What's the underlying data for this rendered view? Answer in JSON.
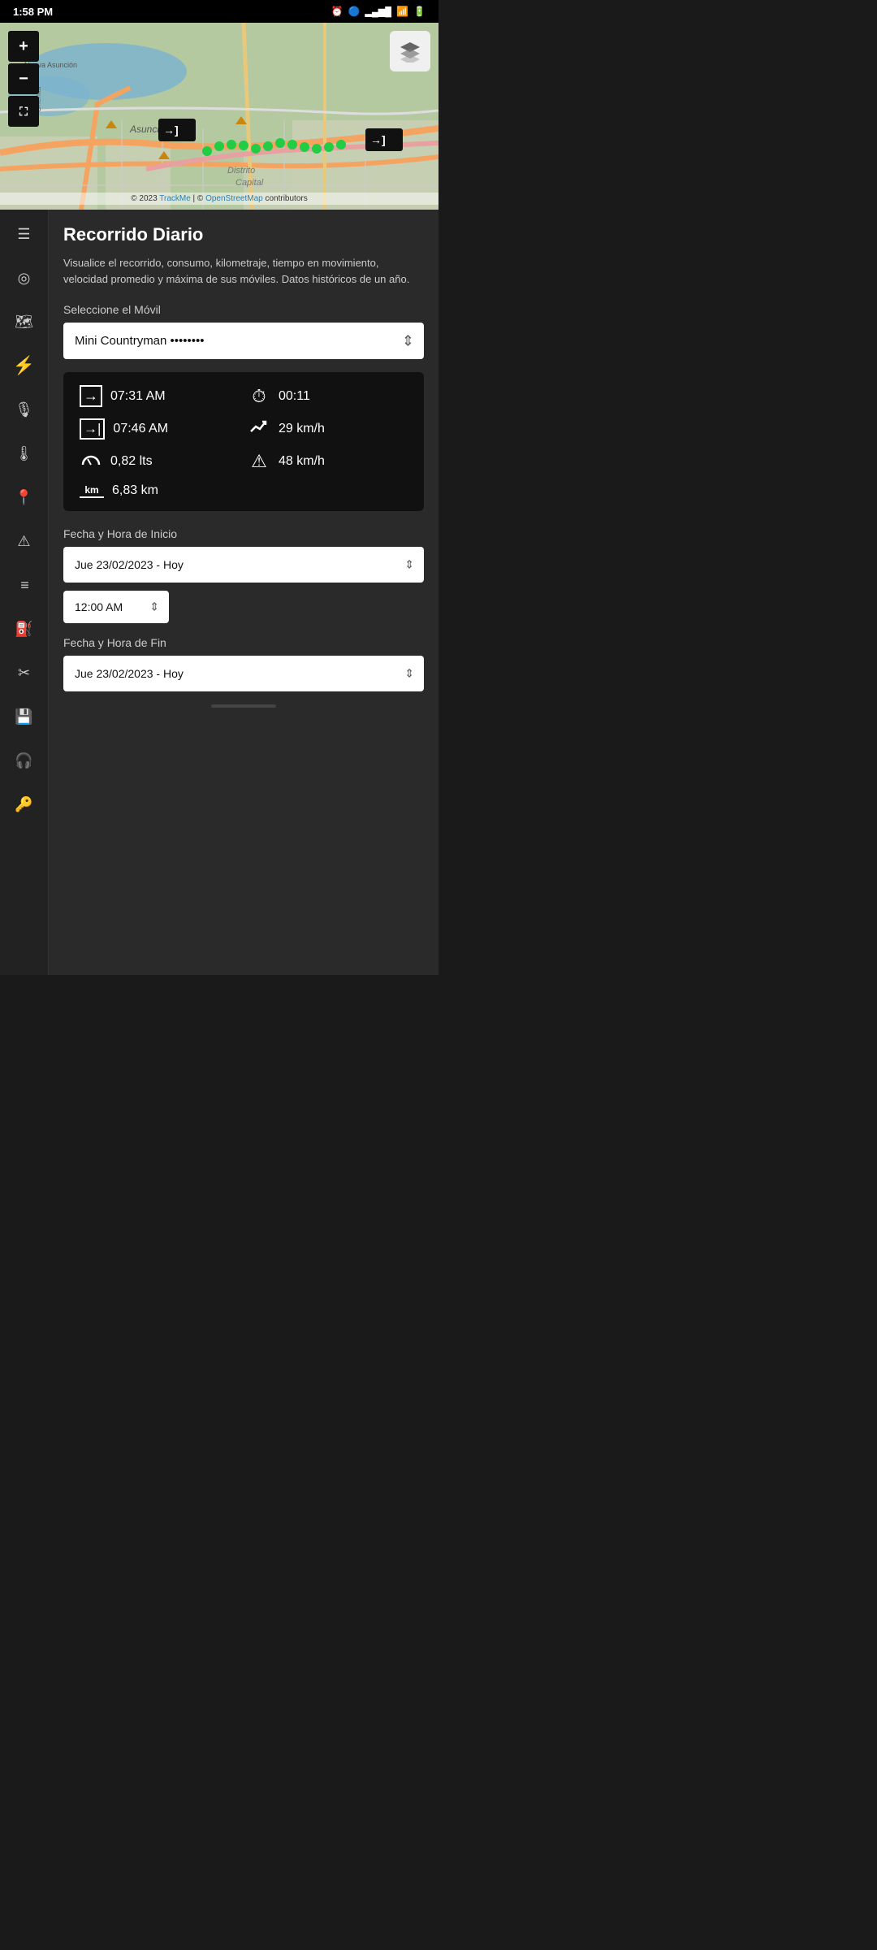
{
  "status_bar": {
    "time": "1:58 PM",
    "alarm_icon": "⏰",
    "bluetooth_icon": "⚡",
    "signal_icon": "📶",
    "wifi_icon": "📶",
    "battery_icon": "🔋"
  },
  "map": {
    "attribution": "© 2023 TrackMe | © OpenStreetMap contributors",
    "attribution_trackme": "TrackMe",
    "attribution_osm": "OpenStreetMap",
    "layers_icon": "layers-icon",
    "zoom_in_label": "+",
    "zoom_out_label": "−",
    "fit_icon": "⛶",
    "flag_start": "→]",
    "flag_end": "→]"
  },
  "sidebar": {
    "items": [
      {
        "name": "menu-icon",
        "label": "≡",
        "icon": "☰"
      },
      {
        "name": "location-icon",
        "label": "location",
        "icon": "◎"
      },
      {
        "name": "map-icon",
        "label": "map",
        "icon": "🗺"
      },
      {
        "name": "lightning-icon",
        "label": "lightning",
        "icon": "⚡"
      },
      {
        "name": "microphone-icon",
        "label": "microphone",
        "icon": "🎤"
      },
      {
        "name": "temperature-icon",
        "label": "temperature",
        "icon": "🌡"
      },
      {
        "name": "pin-icon",
        "label": "pin",
        "icon": "📍"
      },
      {
        "name": "alert-icon",
        "label": "alert",
        "icon": "⚠"
      },
      {
        "name": "list-icon",
        "label": "list",
        "icon": "≡"
      },
      {
        "name": "fuel-icon",
        "label": "fuel",
        "icon": "⛽"
      },
      {
        "name": "tools-icon",
        "label": "tools",
        "icon": "✂"
      },
      {
        "name": "save-icon",
        "label": "save",
        "icon": "💾"
      },
      {
        "name": "support-icon",
        "label": "support",
        "icon": "🎧"
      },
      {
        "name": "key-icon",
        "label": "key",
        "icon": "🔑"
      }
    ]
  },
  "main": {
    "title": "Recorrido Diario",
    "description": "Visualice el recorrido, consumo, kilometraje, tiempo en movimiento, velocidad promedio y máxima de sus móviles. Datos históricos de un año.",
    "vehicle_label": "Seleccione el Móvil",
    "vehicle_name": "Mini Countryman",
    "vehicle_plate_blur": "••••••••",
    "stats": {
      "start_time_icon": "→",
      "start_time": "07:31 AM",
      "duration_icon": "⏱",
      "duration": "00:11",
      "end_time_icon": "→]",
      "end_time": "07:46 AM",
      "avg_speed_icon": "📈",
      "avg_speed": "29 km/h",
      "fuel_icon": "⌒",
      "fuel": "0,82 lts",
      "max_speed_icon": "⚠",
      "max_speed": "48 km/h",
      "distance_icon": "km",
      "distance": "6,83 km"
    },
    "start_datetime_label": "Fecha y Hora de Inicio",
    "start_date_value": "Jue 23/02/2023 - Hoy",
    "start_time_value": "12:00 AM",
    "end_datetime_label": "Fecha y Hora de Fin",
    "end_date_value": "Jue 23/02/2023 - Hoy"
  }
}
